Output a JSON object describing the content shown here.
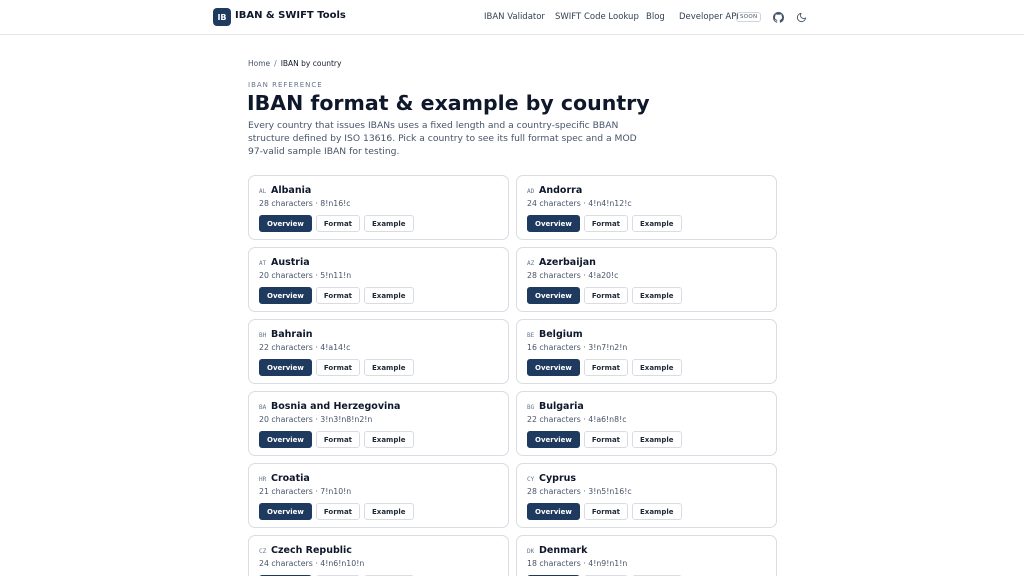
{
  "header": {
    "logo_text": "IB",
    "brand": "IBAN & SWIFT Tools",
    "nav": {
      "iban_validator": "IBAN Validator",
      "swift_lookup": "SWIFT Code Lookup",
      "blog": "Blog",
      "developer_api": "Developer API",
      "soon_badge": "SOON"
    },
    "icons": [
      "github-icon",
      "moon-icon"
    ]
  },
  "breadcrumb": {
    "home": "Home",
    "separator": "/",
    "current": "IBAN by country"
  },
  "hero": {
    "eyebrow": "IBAN REFERENCE",
    "title": "IBAN format & example by country",
    "description": "Every country that issues IBANs uses a fixed length and a country-specific BBAN structure defined by ISO 13616. Pick a country to see its full format spec and a MOD 97-valid sample IBAN for testing."
  },
  "buttons": {
    "overview": "Overview",
    "format": "Format",
    "example": "Example"
  },
  "colors": {
    "brand_navy": "#1e3a5f",
    "border": "#d9dde3",
    "muted_text": "#475569"
  },
  "countries": [
    {
      "code": "AL",
      "name": "Albania",
      "meta": "28 characters · 8!n16!c"
    },
    {
      "code": "AD",
      "name": "Andorra",
      "meta": "24 characters · 4!n4!n12!c"
    },
    {
      "code": "AT",
      "name": "Austria",
      "meta": "20 characters · 5!n11!n"
    },
    {
      "code": "AZ",
      "name": "Azerbaijan",
      "meta": "28 characters · 4!a20!c"
    },
    {
      "code": "BH",
      "name": "Bahrain",
      "meta": "22 characters · 4!a14!c"
    },
    {
      "code": "BE",
      "name": "Belgium",
      "meta": "16 characters · 3!n7!n2!n"
    },
    {
      "code": "BA",
      "name": "Bosnia and Herzegovina",
      "meta": "20 characters · 3!n3!n8!n2!n"
    },
    {
      "code": "BG",
      "name": "Bulgaria",
      "meta": "22 characters · 4!a6!n8!c"
    },
    {
      "code": "HR",
      "name": "Croatia",
      "meta": "21 characters · 7!n10!n"
    },
    {
      "code": "CY",
      "name": "Cyprus",
      "meta": "28 characters · 3!n5!n16!c"
    },
    {
      "code": "CZ",
      "name": "Czech Republic",
      "meta": "24 characters · 4!n6!n10!n"
    },
    {
      "code": "DK",
      "name": "Denmark",
      "meta": "18 characters · 4!n9!n1!n"
    }
  ]
}
